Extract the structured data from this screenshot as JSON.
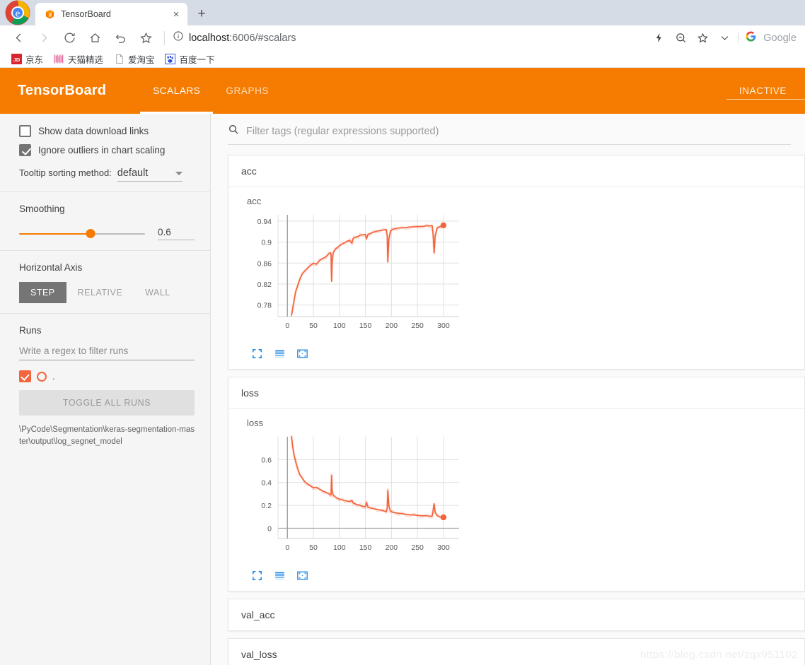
{
  "browser": {
    "tab": {
      "title": "TensorBoard",
      "favicon": "tensorboard-cube-icon",
      "close": "×"
    },
    "new_tab": "+",
    "nav": {
      "back": "back-icon",
      "forward": "forward-icon",
      "reload": "reload-icon",
      "home": "home-icon",
      "undo": "undo-icon",
      "bookmark": "star-icon"
    },
    "url_prefix": "localhost",
    "url_suffix": ":6006/#scalars",
    "omni_icons": [
      "lightning-icon",
      "zoom-out-icon",
      "star-icon",
      "chevron-down-icon"
    ],
    "search_engine": {
      "icon": "google-g-icon",
      "label": "Google"
    },
    "bookmarks": [
      {
        "label": "京东",
        "icon": "jd-icon"
      },
      {
        "label": "天猫精选",
        "icon": "tmall-icon"
      },
      {
        "label": "爱淘宝",
        "icon": "page-icon"
      },
      {
        "label": "百度一下",
        "icon": "baidu-paw-icon"
      }
    ]
  },
  "tensorboard": {
    "brand": "TensorBoard",
    "accent_color": "#f57c00",
    "tabs": [
      {
        "label": "SCALARS",
        "active": true
      },
      {
        "label": "GRAPHS",
        "active": false
      }
    ],
    "inactive_label": "INACTIVE"
  },
  "sidebar": {
    "checkboxes": [
      {
        "label": "Show data download links",
        "checked": false
      },
      {
        "label": "Ignore outliers in chart scaling",
        "checked": true
      }
    ],
    "tooltip": {
      "label": "Tooltip sorting method:",
      "value": "default"
    },
    "smoothing": {
      "label": "Smoothing",
      "value": "0.6",
      "percent": 57
    },
    "horizontal_axis": {
      "label": "Horizontal Axis",
      "options": [
        {
          "label": "STEP",
          "active": true
        },
        {
          "label": "RELATIVE",
          "active": false
        },
        {
          "label": "WALL",
          "active": false
        }
      ]
    },
    "runs": {
      "label": "Runs",
      "filter_placeholder": "Write a regex to filter runs",
      "entry": {
        "name": ".",
        "checked": true,
        "color": "#f4643c"
      },
      "toggle_all": "TOGGLE ALL RUNS",
      "path": "\\PyCode\\Segmentation\\keras-segmentation-master\\output\\log_segnet_model"
    }
  },
  "content": {
    "filter_placeholder": "Filter tags (regular expressions supported)",
    "filter_icon": "search-icon",
    "cards": [
      {
        "title": "acc",
        "expanded": true,
        "chart": "acc"
      },
      {
        "title": "loss",
        "expanded": true,
        "chart": "loss"
      },
      {
        "title": "val_acc",
        "expanded": false
      },
      {
        "title": "val_loss",
        "expanded": false
      }
    ],
    "chart_tools": [
      "expand-icon",
      "data-series-icon",
      "fit-domain-icon"
    ]
  },
  "watermark": "https://blog.csdn.net/zqx951102",
  "chart_data": [
    {
      "id": "acc",
      "type": "line",
      "title": "acc",
      "xlabel": "",
      "ylabel": "",
      "xlim": [
        -18,
        330
      ],
      "ylim": [
        0.758,
        0.952
      ],
      "xticks": [
        0,
        50,
        100,
        150,
        200,
        250,
        300
      ],
      "yticks": [
        0.78,
        0.82,
        0.86,
        0.9,
        0.94
      ],
      "grid": true,
      "legend": false,
      "line_color": "#f4643c",
      "last_point": {
        "x": 300,
        "y": 0.932
      },
      "series": [
        {
          "name": "log_segnet_model",
          "x": [
            8,
            10,
            13,
            16,
            20,
            24,
            28,
            33,
            38,
            44,
            50,
            56,
            62,
            68,
            74,
            80,
            83,
            84,
            85,
            86,
            88,
            92,
            96,
            100,
            105,
            110,
            115,
            120,
            124,
            126,
            128,
            132,
            136,
            140,
            145,
            150,
            152,
            155,
            160,
            166,
            172,
            178,
            184,
            190,
            192,
            193,
            195,
            198,
            202,
            208,
            214,
            220,
            228,
            236,
            244,
            252,
            260,
            268,
            274,
            278,
            280,
            282,
            284,
            288,
            294,
            300
          ],
          "y": [
            0.76,
            0.772,
            0.79,
            0.805,
            0.818,
            0.83,
            0.838,
            0.845,
            0.85,
            0.855,
            0.86,
            0.858,
            0.865,
            0.869,
            0.872,
            0.878,
            0.88,
            0.876,
            0.825,
            0.862,
            0.88,
            0.886,
            0.89,
            0.893,
            0.896,
            0.899,
            0.902,
            0.903,
            0.898,
            0.906,
            0.908,
            0.91,
            0.911,
            0.913,
            0.914,
            0.915,
            0.906,
            0.915,
            0.917,
            0.919,
            0.921,
            0.922,
            0.923,
            0.924,
            0.912,
            0.862,
            0.905,
            0.921,
            0.924,
            0.926,
            0.927,
            0.927,
            0.928,
            0.929,
            0.929,
            0.93,
            0.93,
            0.931,
            0.931,
            0.932,
            0.916,
            0.88,
            0.912,
            0.927,
            0.93,
            0.932
          ]
        }
      ]
    },
    {
      "id": "loss",
      "type": "line",
      "title": "loss",
      "xlabel": "",
      "ylabel": "",
      "xlim": [
        -18,
        330
      ],
      "ylim": [
        -0.09,
        0.8
      ],
      "xticks": [
        0,
        50,
        100,
        150,
        200,
        250,
        300
      ],
      "yticks": [
        0,
        0.2,
        0.4,
        0.6
      ],
      "grid": true,
      "legend": false,
      "line_color": "#f4643c",
      "last_point": {
        "x": 300,
        "y": 0.095
      },
      "series": [
        {
          "name": "log_segnet_model",
          "x": [
            8,
            10,
            13,
            16,
            20,
            24,
            28,
            33,
            38,
            44,
            50,
            56,
            62,
            68,
            74,
            80,
            83,
            84,
            85,
            86,
            88,
            92,
            96,
            100,
            105,
            110,
            115,
            120,
            124,
            126,
            128,
            132,
            136,
            140,
            145,
            150,
            152,
            155,
            160,
            166,
            172,
            178,
            184,
            190,
            192,
            193,
            195,
            198,
            202,
            208,
            214,
            220,
            228,
            236,
            244,
            252,
            260,
            268,
            274,
            278,
            280,
            282,
            284,
            288,
            294,
            300
          ],
          "y": [
            0.8,
            0.72,
            0.64,
            0.58,
            0.52,
            0.47,
            0.44,
            0.41,
            0.39,
            0.37,
            0.355,
            0.358,
            0.34,
            0.325,
            0.315,
            0.3,
            0.29,
            0.295,
            0.46,
            0.33,
            0.29,
            0.272,
            0.262,
            0.255,
            0.248,
            0.242,
            0.238,
            0.232,
            0.245,
            0.222,
            0.218,
            0.21,
            0.205,
            0.198,
            0.192,
            0.188,
            0.225,
            0.185,
            0.178,
            0.17,
            0.165,
            0.16,
            0.152,
            0.145,
            0.18,
            0.33,
            0.2,
            0.15,
            0.14,
            0.135,
            0.13,
            0.127,
            0.122,
            0.118,
            0.115,
            0.112,
            0.11,
            0.108,
            0.106,
            0.104,
            0.15,
            0.215,
            0.14,
            0.108,
            0.1,
            0.095
          ]
        }
      ]
    }
  ]
}
